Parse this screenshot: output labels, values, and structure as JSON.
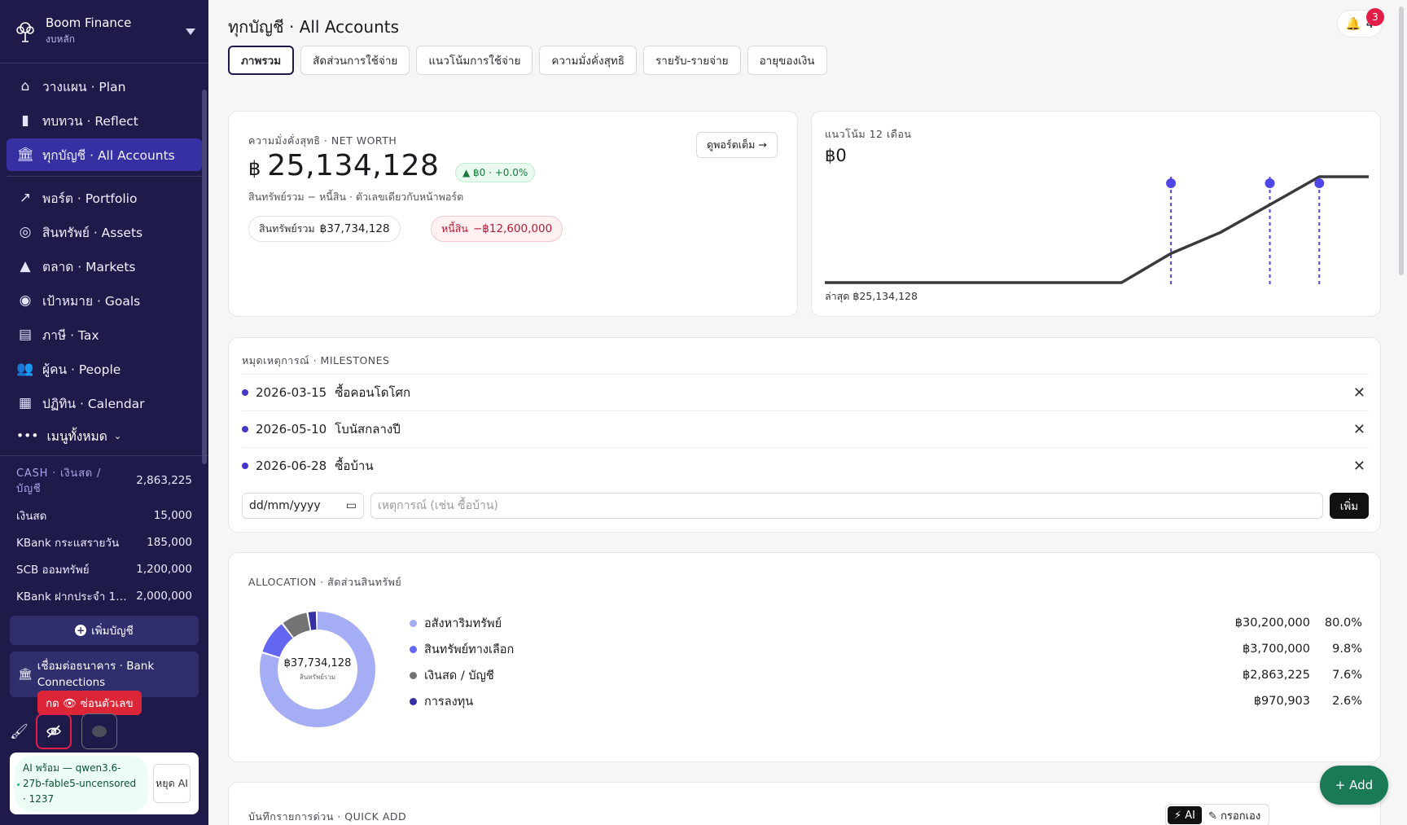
{
  "brand": {
    "name": "Boom Finance",
    "sub": "งบหลัก"
  },
  "nav": [
    {
      "label": "วางแผน · Plan",
      "icon": "plan-icon"
    },
    {
      "label": "ทบทวน · Reflect",
      "icon": "reflect-icon"
    },
    {
      "label": "ทุกบัญชี · All Accounts",
      "icon": "bank-icon"
    },
    {
      "label": "พอร์ต · Portfolio",
      "icon": "portfolio-icon"
    },
    {
      "label": "สินทรัพย์ · Assets",
      "icon": "assets-icon"
    },
    {
      "label": "ตลาด · Markets",
      "icon": "markets-icon"
    },
    {
      "label": "เป้าหมาย · Goals",
      "icon": "goals-icon"
    },
    {
      "label": "ภาษี · Tax",
      "icon": "tax-icon"
    },
    {
      "label": "ผู้คน · People",
      "icon": "people-icon"
    },
    {
      "label": "ปฏิทิน · Calendar",
      "icon": "calendar-icon"
    }
  ],
  "menu_all": "เมนูทั้งหมด",
  "cash": {
    "title": "CASH · เงินสด / บัญชี",
    "total": "2,863,225",
    "rows": [
      {
        "name": "เงินสด",
        "amount": "15,000"
      },
      {
        "name": "KBank กระแสรายวัน",
        "amount": "185,000"
      },
      {
        "name": "SCB ออมทรัพย์",
        "amount": "1,200,000"
      },
      {
        "name": "KBank ฝากประจำ 12 เ...",
        "amount": "2,000,000"
      }
    ]
  },
  "add_account": "เพิ่มบัญชี",
  "bank_connections": "เชื่อมต่อธนาคาร · Bank Connections",
  "tooltip": "กด 👁 ซ่อนตัวเลข",
  "ai": {
    "status": "AI พร้อม — qwen3.6-27b-fable5-uncensored · 1237",
    "stop": "หยุด AI"
  },
  "header": {
    "title": "ทุกบัญชี · All Accounts",
    "notifications": "4",
    "badge": "3"
  },
  "tabs": [
    "ภาพรวม",
    "สัดส่วนการใช้จ่าย",
    "แนวโน้มการใช้จ่าย",
    "ความมั่งคั่งสุทธิ",
    "รายรับ-รายจ่าย",
    "อายุของเงิน"
  ],
  "net_worth": {
    "label": "ความมั่งคั่งสุทธิ · NET WORTH",
    "currency": "฿",
    "value": "25,134,128",
    "delta": "▲ ฿0 · +0.0%",
    "subtitle": "สินทรัพย์รวม − หนี้สิน · ตัวเลขเดียวกับหน้าพอร์ต",
    "view_portfolio": "ดูพอร์ตเต็ม →",
    "assets_label": "สินทรัพย์รวม",
    "assets_value": "฿37,734,128",
    "debt_label": "หนี้สิน",
    "debt_value": "−฿12,600,000"
  },
  "trend": {
    "label": "แนวโน้ม 12 เดือน",
    "value": "฿0",
    "footer": "ล่าสุด ฿25,134,128",
    "values": [
      12534128,
      12534128,
      12534128,
      12534128,
      12534128,
      12534128,
      12534128,
      16000000,
      18500000,
      21800000,
      25134128,
      25134128
    ],
    "markers": [
      7,
      9,
      10
    ],
    "colors": {
      "line": "#3a3a3a",
      "marker": "#4f46e5"
    }
  },
  "milestones": {
    "label": "หมุดเหตุการณ์ · MILESTONES",
    "items": [
      {
        "date": "2026-03-15",
        "title": "ซื้อคอนโดโศก"
      },
      {
        "date": "2026-05-10",
        "title": "โบนัสกลางปี"
      },
      {
        "date": "2026-06-28",
        "title": "ซื้อบ้าน"
      }
    ],
    "date_placeholder": "dd/mm/yyyy",
    "text_placeholder": "เหตุการณ์ (เช่น ซื้อบ้าน)",
    "add_label": "เพิ่ม"
  },
  "allocation": {
    "label": "ALLOCATION · สัดส่วนสินทรัพย์",
    "center_value": "฿37,734,128",
    "center_sub": "สินทรัพย์รวม",
    "items": [
      {
        "name": "อสังหาริมทรัพย์",
        "amount": "฿30,200,000",
        "pct": "80.0%",
        "value": 80.0,
        "color": "#a5aef5"
      },
      {
        "name": "สินทรัพย์ทางเลือก",
        "amount": "฿3,700,000",
        "pct": "9.8%",
        "value": 9.8,
        "color": "#6366f1"
      },
      {
        "name": "เงินสด / บัญชี",
        "amount": "฿2,863,225",
        "pct": "7.6%",
        "value": 7.6,
        "color": "#737373"
      },
      {
        "name": "การลงทุน",
        "amount": "฿970,903",
        "pct": "2.6%",
        "value": 2.6,
        "color": "#3730a3"
      }
    ]
  },
  "quick_add": {
    "label": "บันทึกรายการด่วน · QUICK ADD",
    "ai": "AI",
    "manual": "กรอกเอง"
  },
  "fab": "+ Add"
}
